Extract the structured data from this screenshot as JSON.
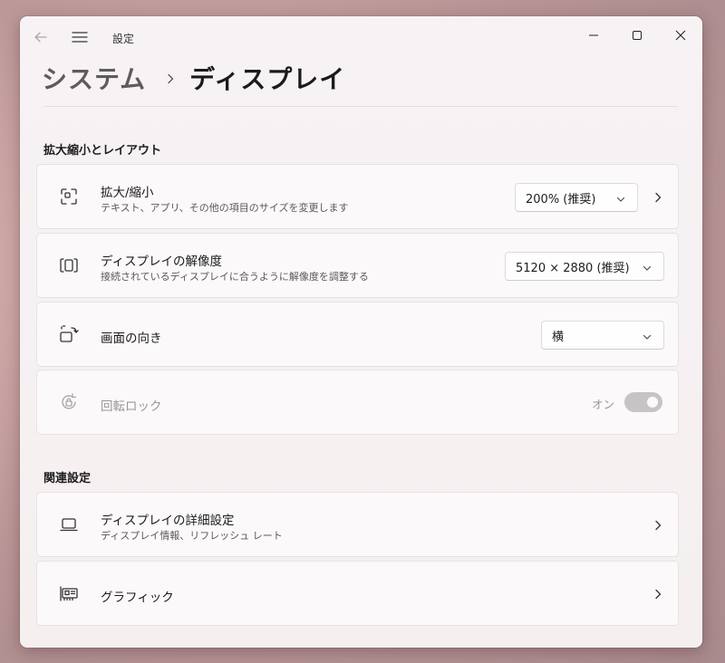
{
  "window": {
    "title": "設定"
  },
  "breadcrumb": {
    "parent": "システム",
    "current": "ディスプレイ"
  },
  "sections": {
    "scale_layout": "拡大縮小とレイアウト",
    "related": "関連設定"
  },
  "scale": {
    "label": "拡大/縮小",
    "sub": "テキスト、アプリ、その他の項目のサイズを変更します",
    "value": "200% (推奨)"
  },
  "resolution": {
    "label": "ディスプレイの解像度",
    "sub": "接続されているディスプレイに合うように解像度を調整する",
    "value": "5120 × 2880 (推奨)"
  },
  "orientation": {
    "label": "画面の向き",
    "value": "横"
  },
  "rotation_lock": {
    "label": "回転ロック",
    "state": "オン",
    "enabled": false,
    "on": true
  },
  "advanced_display": {
    "label": "ディスプレイの詳細設定",
    "sub": "ディスプレイ情報、リフレッシュ レート"
  },
  "graphics": {
    "label": "グラフィック"
  },
  "icons": {
    "back": "back-arrow-icon",
    "menu": "hamburger-menu-icon",
    "scale": "scale-icon",
    "resolution": "resolution-icon",
    "orientation": "orientation-icon",
    "rotation_lock": "rotation-lock-icon",
    "display": "laptop-icon",
    "graphics": "graphics-card-icon"
  }
}
